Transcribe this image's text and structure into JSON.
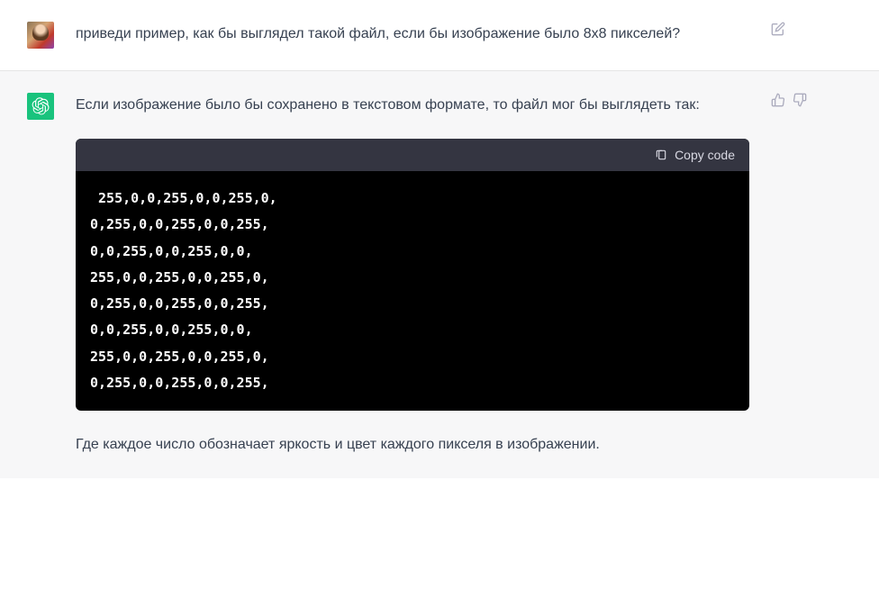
{
  "user": {
    "message": "приведи пример, как бы выглядел такой файл, если бы изображение было 8х8 пикселей?"
  },
  "assistant": {
    "intro": "Если изображение было бы сохранено в текстовом формате, то файл мог бы выглядеть так:",
    "code": " 255,0,0,255,0,0,255,0,\n0,255,0,0,255,0,0,255,\n0,0,255,0,0,255,0,0,\n255,0,0,255,0,0,255,0,\n0,255,0,0,255,0,0,255,\n0,0,255,0,0,255,0,0,\n255,0,0,255,0,0,255,0,\n0,255,0,0,255,0,0,255,",
    "outro": "Где каждое число обозначает яркость и цвет каждого пикселя в изображении.",
    "copy_label": "Copy code"
  }
}
